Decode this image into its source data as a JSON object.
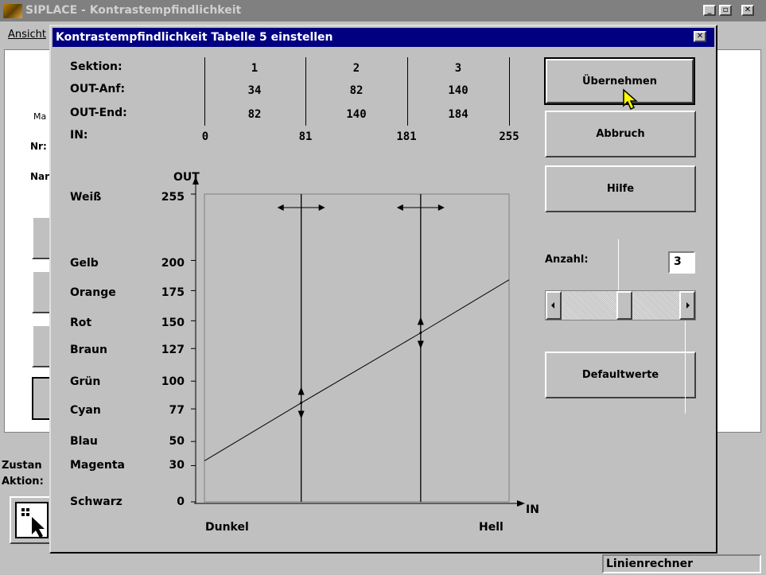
{
  "main_window": {
    "title": "SIPLACE - Kontrastempfindlichkeit",
    "menu_item": "Ansicht",
    "side_labels": {
      "group": "Ma",
      "nr": "Nr:",
      "name": "Nar"
    },
    "zustand": "Zustan",
    "aktion": "Aktion:",
    "status_right": "Linienrechner",
    "controls": [
      "_",
      "🗗",
      "✕"
    ]
  },
  "dialog": {
    "title": "Kontrastempfindlichkeit Tabelle 5 einstellen",
    "close": "✕",
    "table": {
      "row_labels": {
        "sektion": "Sektion:",
        "out_anf": "OUT-Anf:",
        "out_end": "OUT-End:",
        "in": "IN:"
      },
      "sections": [
        {
          "nr": "1",
          "out_anf": "34",
          "out_end": "82"
        },
        {
          "nr": "2",
          "out_anf": "82",
          "out_end": "140"
        },
        {
          "nr": "3",
          "out_anf": "140",
          "out_end": "184"
        }
      ],
      "in_values": [
        "0",
        "81",
        "181",
        "255"
      ]
    },
    "chart": {
      "y_axis_label": "OUT",
      "x_axis_label": "IN",
      "x_left": "Dunkel",
      "x_right": "Hell",
      "colors": [
        {
          "name": "Weiß",
          "value": "255"
        },
        {
          "name": "Gelb",
          "value": "200"
        },
        {
          "name": "Orange",
          "value": "175"
        },
        {
          "name": "Rot",
          "value": "150"
        },
        {
          "name": "Braun",
          "value": "127"
        },
        {
          "name": "Grün",
          "value": "100"
        },
        {
          "name": "Cyan",
          "value": "77"
        },
        {
          "name": "Blau",
          "value": "50"
        },
        {
          "name": "Magenta",
          "value": "30"
        },
        {
          "name": "Schwarz",
          "value": "0"
        }
      ]
    },
    "buttons": {
      "apply": "Übernehmen",
      "cancel": "Abbruch",
      "help": "Hilfe",
      "defaults": "Defaultwerte"
    },
    "anzahl": {
      "label": "Anzahl:",
      "value": "3"
    },
    "slider_level_fraction": 0.54
  },
  "chart_data": {
    "type": "line",
    "xlabel": "IN",
    "ylabel": "OUT",
    "xlim": [
      0,
      255
    ],
    "ylim": [
      0,
      255
    ],
    "series": [
      {
        "points": [
          [
            0,
            34
          ],
          [
            81,
            82
          ],
          [
            181,
            140
          ],
          [
            255,
            184
          ]
        ]
      }
    ],
    "section_boundaries_in": [
      81,
      181
    ],
    "yticks": [
      0,
      30,
      50,
      77,
      100,
      127,
      150,
      175,
      200,
      255
    ]
  }
}
